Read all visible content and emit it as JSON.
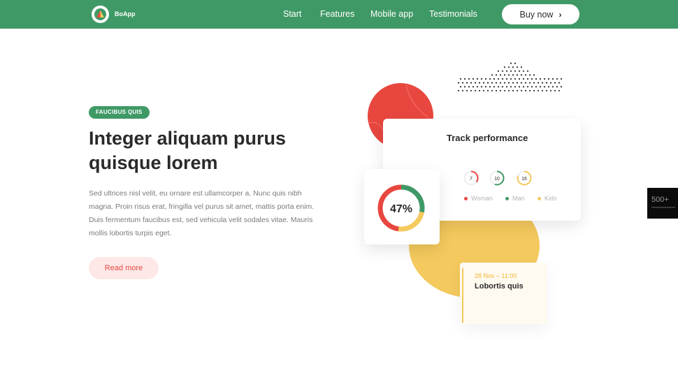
{
  "brand": {
    "name": "BoApp"
  },
  "nav": {
    "links": [
      "Start",
      "Features",
      "Mobile app",
      "Testimonials"
    ],
    "cta": "Buy now"
  },
  "hero": {
    "badge": "FAUCIBUS QUIS",
    "title": "Integer aliquam purus quisque lorem",
    "description": "Sed ultrices nisl velit, eu ornare est ullamcorper a. Nunc quis nibh magna. Proin risus erat, fringilla vel purus sit amet, mattis porta enim. Duis fermentum faucibus est, sed vehicula velit sodales vitae. Mauris mollis lobortis turpis eget.",
    "read_more": "Read more"
  },
  "performance": {
    "title": "Track performance",
    "metrics": [
      {
        "label": "Woman",
        "value": "7",
        "color": "#e8473f",
        "fraction": 0.35
      },
      {
        "label": "Man",
        "value": "10",
        "color": "#3f9966",
        "fraction": 0.55
      },
      {
        "label": "Kids",
        "value": "16",
        "color": "#f4c95d",
        "fraction": 0.8
      }
    ]
  },
  "percentage": {
    "label": "47%",
    "segments": [
      {
        "color": "#3f9966",
        "fraction": 0.28
      },
      {
        "color": "#f4c95d",
        "fraction": 0.24
      },
      {
        "color": "#e8473f",
        "fraction": 0.48
      }
    ]
  },
  "event": {
    "date": "28 Nov – 11:00",
    "title": "Lobortis quis"
  },
  "side_badge": {
    "count": "500+"
  },
  "colors": {
    "primary": "#3f9966",
    "accent_red": "#e8473f",
    "accent_yellow": "#f4c95d",
    "text_dark": "#2a2a2a",
    "text_muted": "#7a7a7a"
  }
}
